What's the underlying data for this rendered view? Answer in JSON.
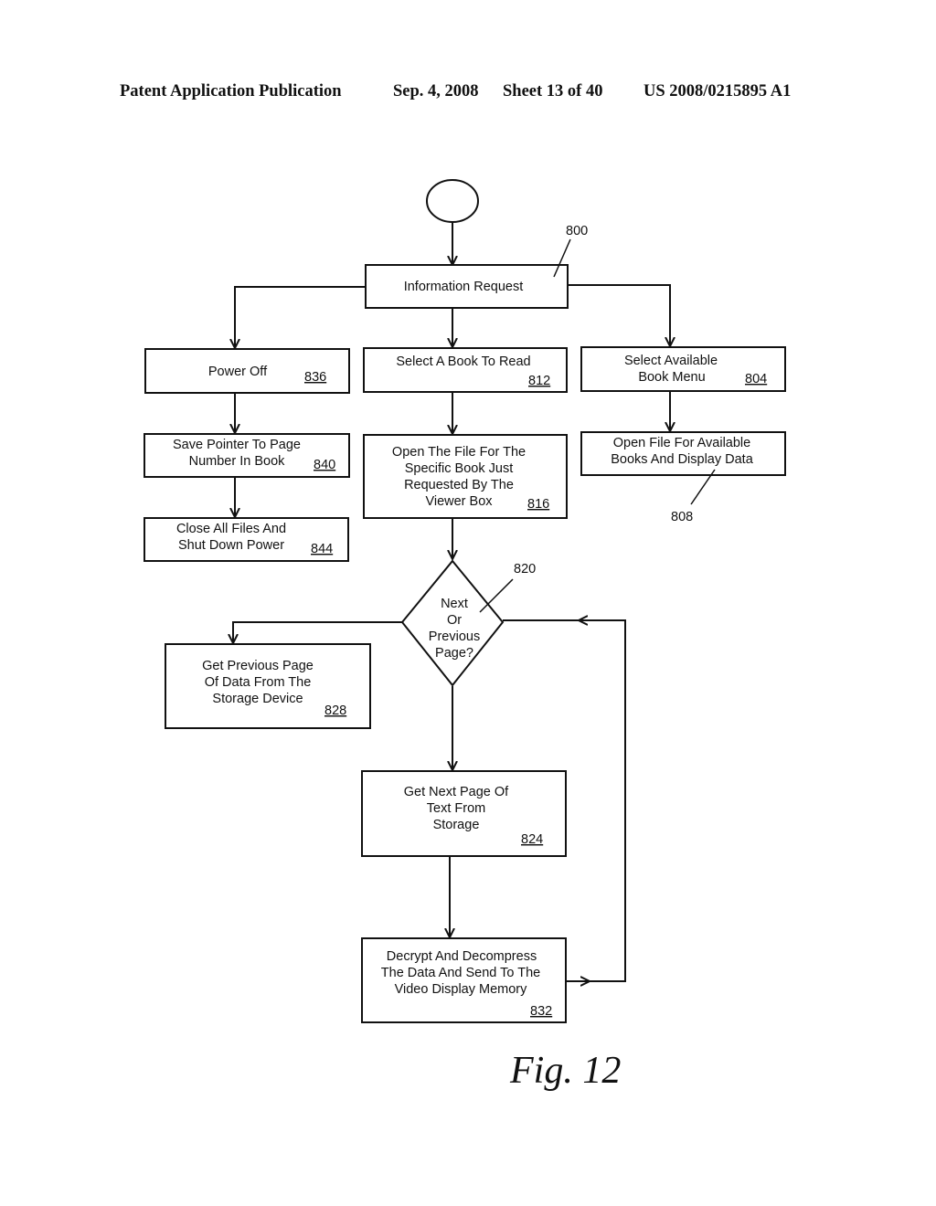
{
  "header": {
    "publication": "Patent Application Publication",
    "date": "Sep. 4, 2008",
    "sheet": "Sheet 13 of 40",
    "number": "US 2008/0215895 A1"
  },
  "figure_label": "Fig. 12",
  "diagram_ref": "800",
  "nodes": {
    "start": {
      "type": "terminal",
      "text": []
    },
    "info_request": {
      "text": [
        "Information Request"
      ],
      "ref": ""
    },
    "power_off": {
      "text": [
        "Power Off"
      ],
      "ref": "836"
    },
    "select_book": {
      "text": [
        "Select A Book To Read"
      ],
      "ref": "812"
    },
    "select_menu": {
      "text": [
        "Select Available",
        "Book Menu"
      ],
      "ref": "804"
    },
    "save_pointer": {
      "text": [
        "Save Pointer To Page",
        "Number In Book"
      ],
      "ref": "840"
    },
    "open_file": {
      "text": [
        "Open The File For The",
        "Specific Book Just",
        "Requested By The",
        "Viewer Box"
      ],
      "ref": "816"
    },
    "open_avail": {
      "text": [
        "Open File For Available",
        "Books And Display Data"
      ],
      "ref": "808"
    },
    "close_files": {
      "text": [
        "Close All Files And",
        "Shut Down Power"
      ],
      "ref": "844"
    },
    "decision": {
      "text": [
        "Next",
        "Or",
        "Previous",
        "Page?"
      ],
      "ref": "820"
    },
    "prev_page": {
      "text": [
        "Get Previous Page",
        "Of Data From The",
        "Storage Device"
      ],
      "ref": "828"
    },
    "next_page": {
      "text": [
        "Get Next Page Of",
        "Text From",
        "Storage"
      ],
      "ref": "824"
    },
    "decrypt": {
      "text": [
        "Decrypt And Decompress",
        "The Data And Send To The",
        "Video Display Memory"
      ],
      "ref": "832"
    }
  }
}
